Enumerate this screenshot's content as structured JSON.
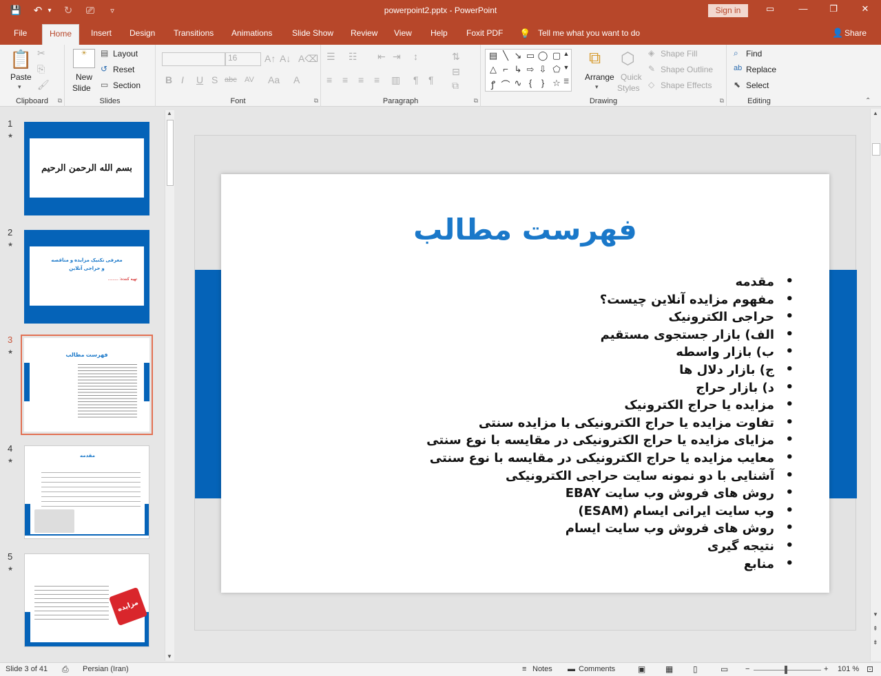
{
  "window": {
    "title": "powerpoint2.pptx - PowerPoint",
    "sign_in": "Sign in",
    "controls": {
      "ribbon_display": "▭",
      "minimize": "—",
      "restore": "❐",
      "close": "✕"
    }
  },
  "qat": {
    "save": "💾",
    "undo": "↶",
    "undo_more": "▾",
    "redo": "↻",
    "present": "⎚",
    "customize": "▿"
  },
  "tabs": [
    "File",
    "Home",
    "Insert",
    "Design",
    "Transitions",
    "Animations",
    "Slide Show",
    "Review",
    "View",
    "Help",
    "Foxit PDF"
  ],
  "active_tab": "Home",
  "tell_me": "Tell me what you want to do",
  "share": "Share",
  "ribbon": {
    "clipboard": {
      "label": "Clipboard",
      "paste": "Paste"
    },
    "slides": {
      "label": "Slides",
      "new_slide_1": "New",
      "new_slide_2": "Slide",
      "layout": "Layout",
      "reset": "Reset",
      "section": "Section"
    },
    "font": {
      "label": "Font",
      "font_name": "",
      "font_size": "16",
      "bold": "B",
      "italic": "I",
      "underline": "U",
      "shadow": "S",
      "strike": "abc",
      "spacing": "AV",
      "case": "Aa",
      "color": "A"
    },
    "paragraph": {
      "label": "Paragraph"
    },
    "drawing": {
      "label": "Drawing",
      "arrange": "Arrange",
      "quick_styles_1": "Quick",
      "quick_styles_2": "Styles",
      "shape_fill": "Shape Fill",
      "shape_outline": "Shape Outline",
      "shape_effects": "Shape Effects"
    },
    "editing": {
      "label": "Editing",
      "find": "Find",
      "replace": "Replace",
      "select": "Select"
    }
  },
  "thumbnails": [
    {
      "num": "1",
      "star": "★",
      "text_1": "بسم الله الرحمن الرحیم",
      "text_2": ""
    },
    {
      "num": "2",
      "star": "★",
      "text_1": "معرفی تکنیک مزایده و مناقصه",
      "text_2": "و حراجی آنلاین",
      "text_3": "تهیه کننده: ........."
    },
    {
      "num": "3",
      "star": "★",
      "text_1": "فهرست مطالب",
      "text_2": ""
    },
    {
      "num": "4",
      "star": "★",
      "text_1": "مقدمه",
      "text_2": ""
    },
    {
      "num": "5",
      "star": "★",
      "text_1": "مزایده",
      "text_2": ""
    }
  ],
  "slide": {
    "title": "فهرست مطالب",
    "items": [
      "مقدمه",
      "مفهوم مزایده آنلاین چیست؟",
      "حراجی الکترونیک",
      "الف) بازار جستجوی مستقیم",
      "ب) بازار واسطه",
      "ج) بازار دلال ها",
      "د) بازار حراج",
      "مزایده یا حراج الکترونیک",
      "تفاوت مزایده یا حراج الکترونیکی با مزایده سنتی",
      "مزایای مزایده یا حراج الکترونیکی در مقایسه با نوع سنتی",
      "معایب مزایده یا حراج الکترونیکی در مقایسه با نوع سنتی",
      "آشنایی با دو نمونه سایت حراجی الکترونیکی",
      "روش های فروش وب سایت EBAY",
      "وب سایت ایرانی ایسام (ESAM)",
      "روش های فروش وب سایت ایسام",
      "نتیجه گیری",
      "منابع"
    ]
  },
  "status": {
    "slide_info": "Slide 3 of 41",
    "language": "Persian (Iran)",
    "notes": "Notes",
    "comments": "Comments",
    "zoom": "101 %",
    "zoom_minus": "−",
    "zoom_plus": "+"
  },
  "colors": {
    "accent": "#b7472a",
    "slide_blue": "#0563b8",
    "title_blue": "#1a78c9",
    "selection": "#e27052"
  }
}
